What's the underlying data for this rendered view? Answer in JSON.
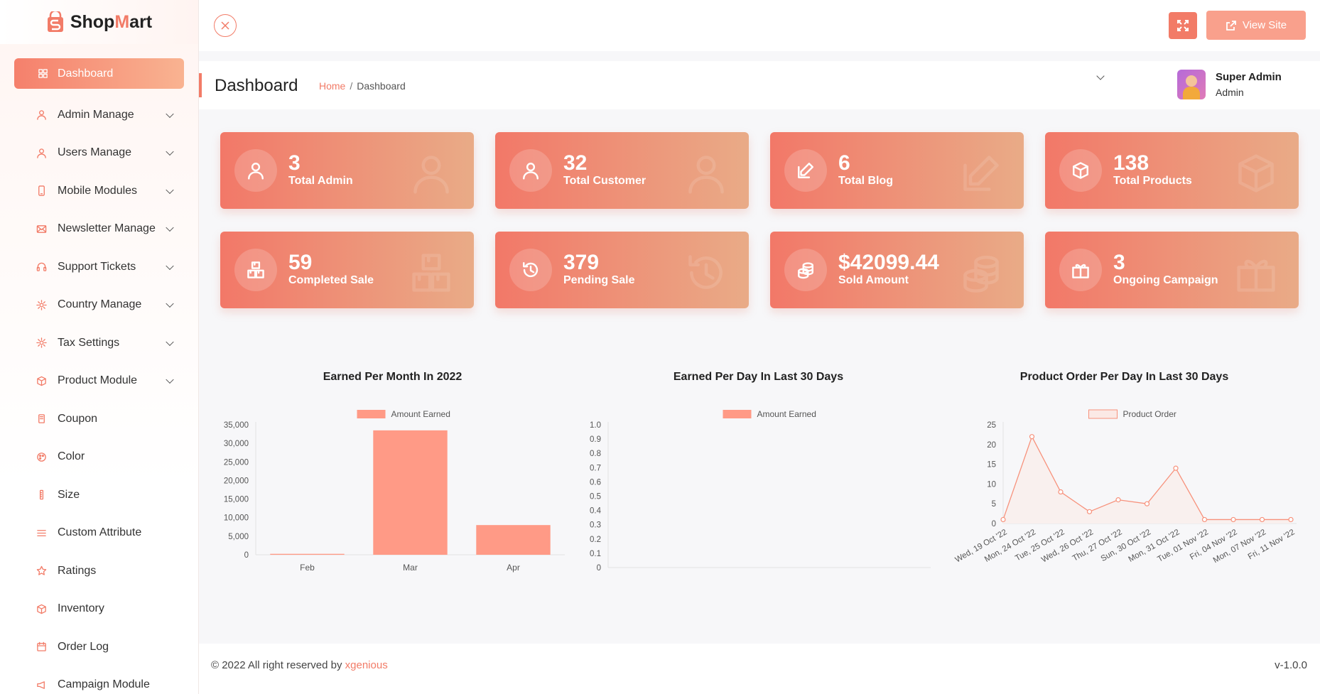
{
  "brand": {
    "name_part1": "Shop",
    "name_part2": "M",
    "name_part3": "art",
    "accent_color": "#f27b67"
  },
  "sidebar": {
    "items": [
      {
        "label": "Dashboard",
        "icon": "grid-icon",
        "active": true,
        "expandable": false
      },
      {
        "label": "Admin Manage",
        "icon": "user-icon",
        "expandable": true
      },
      {
        "label": "Users Manage",
        "icon": "user-icon",
        "expandable": true
      },
      {
        "label": "Mobile Modules",
        "icon": "mobile-icon",
        "expandable": true
      },
      {
        "label": "Newsletter Manage",
        "icon": "mail-icon",
        "expandable": true
      },
      {
        "label": "Support Tickets",
        "icon": "headset-icon",
        "expandable": true
      },
      {
        "label": "Country Manage",
        "icon": "gear-icon",
        "expandable": true
      },
      {
        "label": "Tax Settings",
        "icon": "gear-icon",
        "expandable": true
      },
      {
        "label": "Product Module",
        "icon": "box-icon",
        "expandable": true
      },
      {
        "label": "Coupon",
        "icon": "coupon-icon",
        "expandable": false
      },
      {
        "label": "Color",
        "icon": "palette-icon",
        "expandable": false
      },
      {
        "label": "Size",
        "icon": "ruler-icon",
        "expandable": false
      },
      {
        "label": "Custom Attribute",
        "icon": "list-icon",
        "expandable": false
      },
      {
        "label": "Ratings",
        "icon": "star-icon",
        "expandable": false
      },
      {
        "label": "Inventory",
        "icon": "box-icon",
        "expandable": false
      },
      {
        "label": "Order Log",
        "icon": "calendar-icon",
        "expandable": false
      },
      {
        "label": "Campaign Module",
        "icon": "megaphone-icon",
        "expandable": false
      }
    ]
  },
  "topbar": {
    "view_site_label": "View Site"
  },
  "header": {
    "title": "Dashboard",
    "breadcrumb": {
      "home": "Home",
      "sep": "/",
      "current": "Dashboard"
    },
    "user": {
      "name": "Super Admin",
      "role": "Admin"
    }
  },
  "stats": [
    {
      "value": "3",
      "label": "Total Admin",
      "icon": "user-icon"
    },
    {
      "value": "32",
      "label": "Total Customer",
      "icon": "user-icon"
    },
    {
      "value": "6",
      "label": "Total Blog",
      "icon": "edit-icon"
    },
    {
      "value": "138",
      "label": "Total Products",
      "icon": "box-icon"
    },
    {
      "value": "59",
      "label": "Completed Sale",
      "icon": "boxes-icon"
    },
    {
      "value": "379",
      "label": "Pending Sale",
      "icon": "history-icon"
    },
    {
      "value": "$42099.44",
      "label": "Sold Amount",
      "icon": "coins-icon"
    },
    {
      "value": "3",
      "label": "Ongoing Campaign",
      "icon": "gift-icon"
    }
  ],
  "chart_data": [
    {
      "type": "bar",
      "title": "Earned Per Month In 2022",
      "categories": [
        "Feb",
        "Mar",
        "Apr"
      ],
      "series": [
        {
          "name": "Amount Earned",
          "values": [
            250,
            33500,
            8000
          ]
        }
      ],
      "yticks": [
        "35,000",
        "30,000",
        "25,000",
        "20,000",
        "15,000",
        "10,000",
        "5,000",
        "0"
      ],
      "ylim": [
        0,
        35000
      ],
      "color": "#ff9a86"
    },
    {
      "type": "bar",
      "title": "Earned Per Day In Last 30 Days",
      "categories": [],
      "series": [
        {
          "name": "Amount Earned",
          "values": []
        }
      ],
      "yticks": [
        "1.0",
        "0.9",
        "0.8",
        "0.7",
        "0.6",
        "0.5",
        "0.4",
        "0.3",
        "0.2",
        "0.1",
        "0"
      ],
      "ylim": [
        0,
        1
      ],
      "color": "#ff9a86"
    },
    {
      "type": "line",
      "title": "Product Order Per Day In Last 30 Days",
      "categories": [
        "Wed, 19 Oct '22",
        "Mon, 24 Oct '22",
        "Tue, 25 Oct '22",
        "Wed, 26 Oct '22",
        "Thu, 27 Oct '22",
        "Sun, 30 Oct '22",
        "Mon, 31 Oct '22",
        "Tue, 01 Nov '22",
        "Fri, 04 Nov '22",
        "Mon, 07 Nov '22",
        "Fri, 11 Nov '22"
      ],
      "series": [
        {
          "name": "Product Order",
          "values": [
            1,
            22,
            8,
            3,
            6,
            5,
            14,
            1,
            1,
            1,
            1
          ]
        }
      ],
      "yticks": [
        "25",
        "20",
        "15",
        "10",
        "5",
        "0"
      ],
      "ylim": [
        0,
        25
      ],
      "color": "#f7927c"
    }
  ],
  "footer": {
    "copyright": "© 2022 All right reserved by ",
    "brand": "xgenious",
    "version": "v-1.0.0"
  }
}
